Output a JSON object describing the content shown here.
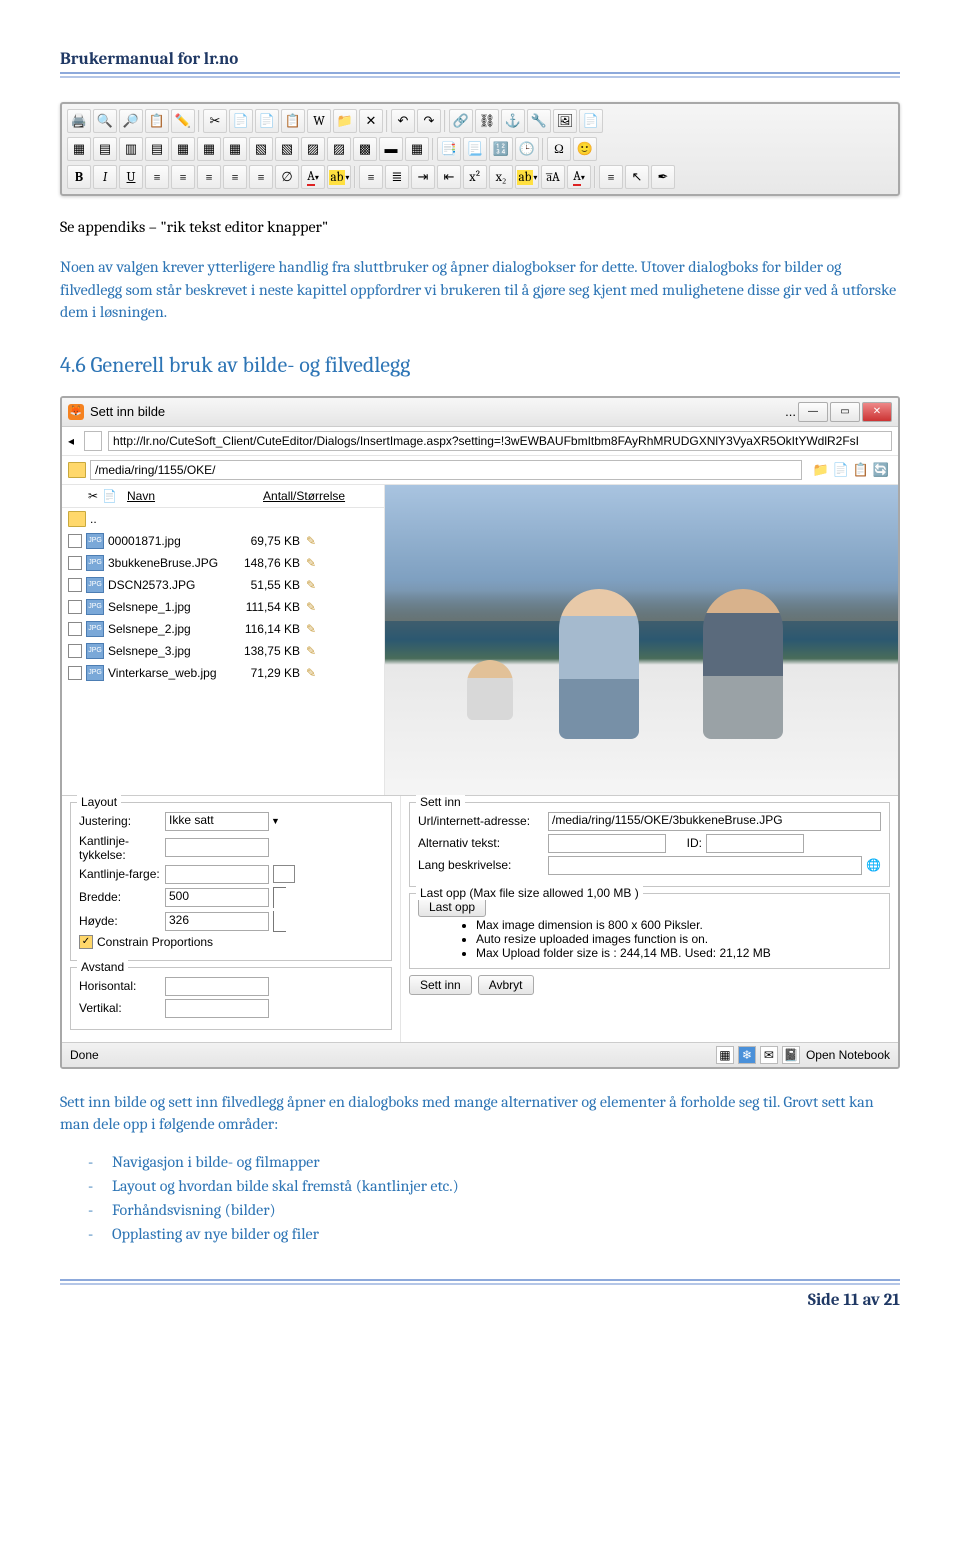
{
  "header": {
    "title": "Brukermanual for lr.no"
  },
  "toolbar_rows": {
    "row1": [
      "🖨️",
      "🔍",
      "🔎",
      "📋",
      "✏️",
      "|",
      "✂",
      "📄",
      "📄",
      "📋",
      "W",
      "📁",
      "✕",
      "|",
      "↶",
      "↷",
      "|",
      "🔗",
      "⛓",
      "⚓",
      "🔧",
      "🖼",
      "📄"
    ],
    "row2": [
      "▦",
      "▤",
      "▥",
      "▤",
      "▦",
      "▦",
      "▦",
      "▧",
      "▧",
      "▨",
      "▨",
      "▩",
      "▬",
      "▦",
      "|",
      "📑",
      "📃",
      "🔢",
      "🕒",
      "|",
      "Ω",
      "🙂"
    ],
    "row3": [
      "B",
      "I",
      "U",
      "≡",
      "≡",
      "≡",
      "≡",
      "≡",
      "∅",
      "A ▾",
      "ab ▾",
      "|",
      "≡",
      "≣",
      "⇥",
      "⇤",
      "x²",
      "x₂",
      "abc",
      "a̅A",
      "Aa",
      "|",
      "≡",
      "↖",
      "✒"
    ]
  },
  "para1": "Se appendiks – \"rik tekst editor knapper\"",
  "para2": "Noen av valgen krever ytterligere handlig fra sluttbruker og åpner dialogbokser for dette. Utover dialogboks for bilder og filvedlegg som står beskrevet i neste kapittel oppfordrer vi brukeren til å gjøre seg kjent med mulighetene disse gir ved å utforske dem i løsningen.",
  "heading": "4.6   Generell bruk av bilde- og filvedlegg",
  "dialog": {
    "title": "Sett inn bilde",
    "url": "http://lr.no/CuteSoft_Client/CuteEditor/Dialogs/InsertImage.aspx?setting=!3wEWBAUFbmItbm8FAyRhMRUDGXNlY3VyaXR5OkItYWdlR2FsI",
    "path": "/media/ring/1155/OKE/",
    "col_name": "Navn",
    "col_size": "Antall/Størrelse",
    "up": "..",
    "files": [
      {
        "name": "00001871.jpg",
        "size": "69,75 KB"
      },
      {
        "name": "3bukkeneBruse.JPG",
        "size": "148,76 KB"
      },
      {
        "name": "DSCN2573.JPG",
        "size": "51,55 KB"
      },
      {
        "name": "Selsnepe_1.jpg",
        "size": "111,54 KB"
      },
      {
        "name": "Selsnepe_2.jpg",
        "size": "116,14 KB"
      },
      {
        "name": "Selsnepe_3.jpg",
        "size": "138,75 KB"
      },
      {
        "name": "Vinterkarse_web.jpg",
        "size": "71,29 KB"
      }
    ],
    "layout": {
      "legend": "Layout",
      "justering_lbl": "Justering:",
      "justering_val": "Ikke satt",
      "kantlinje_tykkelse_lbl": "Kantlinje-tykkelse:",
      "kantlinje_farge_lbl": "Kantlinje-farge:",
      "bredde_lbl": "Bredde:",
      "bredde_val": "500",
      "hoyde_lbl": "Høyde:",
      "hoyde_val": "326",
      "constrain": "Constrain Proportions"
    },
    "avstand": {
      "legend": "Avstand",
      "horisontal": "Horisontal:",
      "vertikal": "Vertikal:"
    },
    "settinn": {
      "legend": "Sett inn",
      "url_lbl": "Url/internett-adresse:",
      "url_val": "/media/ring/1155/OKE/3bukkeneBruse.JPG",
      "alt_lbl": "Alternativ tekst:",
      "id_lbl": "ID:",
      "lang_lbl": "Lang beskrivelse:"
    },
    "upload": {
      "legend": "Last opp (Max file size allowed 1,00 MB )",
      "btn": "Last opp",
      "b1": "Max image dimension is 800 x 600 Piksler.",
      "b2": "Auto resize uploaded images function is on.",
      "b3": "Max Upload folder size is : 244,14 MB. Used: 21,12 MB"
    },
    "insert_btn": "Sett inn",
    "cancel_btn": "Avbryt",
    "status_done": "Done",
    "status_notebook": "Open Notebook"
  },
  "para3": "Sett inn bilde og sett inn filvedlegg åpner en dialogboks med mange alternativer og elementer å forholde seg til. Grovt sett kan man dele opp i følgende områder:",
  "bullets": [
    "Navigasjon i bilde- og filmapper",
    "Layout og hvordan bilde skal fremstå (kantlinjer etc.)",
    "Forhåndsvisning (bilder)",
    "Opplasting av nye bilder og filer"
  ],
  "footer": "Side 11 av 21"
}
